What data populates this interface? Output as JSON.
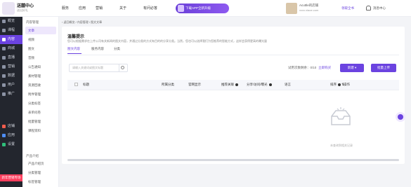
{
  "header": {
    "brand_title": "送囍中心",
    "brand_sub": "送出好礼",
    "nav": [
      "服务",
      "应用",
      "营销",
      "关于",
      "有问必答"
    ],
    "promo": "下载APP全新升级",
    "shop_name": "Acuttle的店铺",
    "shop_url": "xxxx.xiaoe.com",
    "links": [
      "领取全书",
      "消息中心"
    ]
  },
  "sidebar_main": [
    {
      "label": "概览",
      "active": false
    },
    {
      "label": "课程",
      "active": false
    },
    {
      "label": "内容",
      "active": true
    },
    {
      "label": "商城",
      "active": false
    },
    {
      "label": "直播",
      "active": false
    },
    {
      "label": "营销",
      "active": false
    },
    {
      "label": "数据",
      "active": false
    },
    {
      "label": "用户",
      "active": false
    },
    {
      "label": "推广",
      "active": false
    },
    {
      "label": "店铺",
      "active": false
    },
    {
      "label": "应用",
      "active": false
    },
    {
      "label": "设置",
      "active": false
    }
  ],
  "sidebar_badge": "新年营销专场",
  "sidebar_sub": {
    "group1": "内容管理",
    "items1": [
      "文章",
      "视频",
      "图文",
      "音频",
      "公告通知",
      "素材管理",
      "资源回收",
      "附件管理",
      "分类标签",
      "表单问卷",
      "批量管理",
      "课程资料"
    ],
    "group2": "产品介绍",
    "items2": [
      "产品介绍页",
      "分类管理",
      "标签管理"
    ]
  },
  "breadcrumb": [
    "返回概览",
    "内容管理",
    "图文文章"
  ],
  "page": {
    "title": "温馨提示",
    "desc": "您可以根据需求在上传公司有关新闻的图文内容，并通过分类的方式有目的的分享分类。当然，您也可以选择我们为您推荐的智能方式，这样会获得更高的曝光量",
    "tabs": [
      "图文内容",
      "服务内容",
      "分类"
    ],
    "search_placeholder": "请输入关键词或图文标题",
    "limit_text": "试用次数剩余：0/10",
    "limit_link": "立即购买",
    "btn_new": "新建",
    "btn_upload": "批量上传",
    "columns": [
      "标题",
      "所属分类",
      "官网显示",
      "推荐关联",
      "分享/访问/曝光",
      "语言",
      "排序",
      "操作"
    ],
    "empty": "未查询到相关记录"
  }
}
